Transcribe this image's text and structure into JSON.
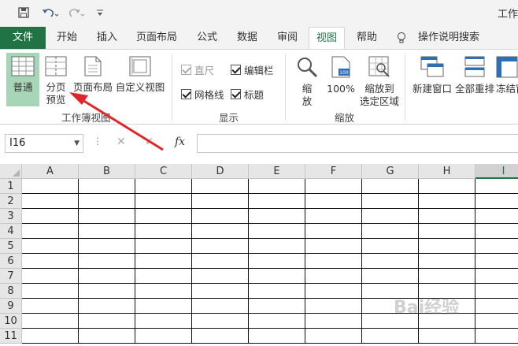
{
  "title_bar": {
    "title": "工作"
  },
  "tabs": [
    {
      "label": "文件"
    },
    {
      "label": "开始"
    },
    {
      "label": "插入"
    },
    {
      "label": "页面布局"
    },
    {
      "label": "公式"
    },
    {
      "label": "数据"
    },
    {
      "label": "审阅"
    },
    {
      "label": "视图"
    },
    {
      "label": "帮助"
    },
    {
      "label": "操作说明搜索"
    }
  ],
  "ribbon": {
    "workbook_views": {
      "normal": "普通",
      "page_break_1": "分页",
      "page_break_2": "预览",
      "page_layout": "页面布局",
      "custom_view": "自定义视图",
      "group_label": "工作簿视图"
    },
    "show": {
      "ruler": "直尺",
      "formula_bar": "编辑栏",
      "gridlines": "网格线",
      "headings": "标题",
      "group_label": "显示"
    },
    "zoom": {
      "zoom_1": "缩",
      "zoom_2": "放",
      "hundred": "100%",
      "zoom_sel_1": "缩放到",
      "zoom_sel_2": "选定区域",
      "group_label": "缩放"
    },
    "window": {
      "new_window": "新建窗口",
      "arrange_all": "全部重排",
      "freeze": "冻结窗"
    }
  },
  "formula_bar": {
    "name_box": "I16",
    "fx": "fx"
  },
  "grid": {
    "columns": [
      "A",
      "B",
      "C",
      "D",
      "E",
      "F",
      "G",
      "H",
      "I"
    ],
    "rows": [
      "1",
      "2",
      "3",
      "4",
      "5",
      "6",
      "7",
      "8",
      "9",
      "10",
      "11"
    ],
    "active_column": "I"
  },
  "watermark": "Bai经验",
  "colors": {
    "accent": "#217346",
    "selected_button": "#a7d5b7",
    "arrow": "#e0262b"
  }
}
